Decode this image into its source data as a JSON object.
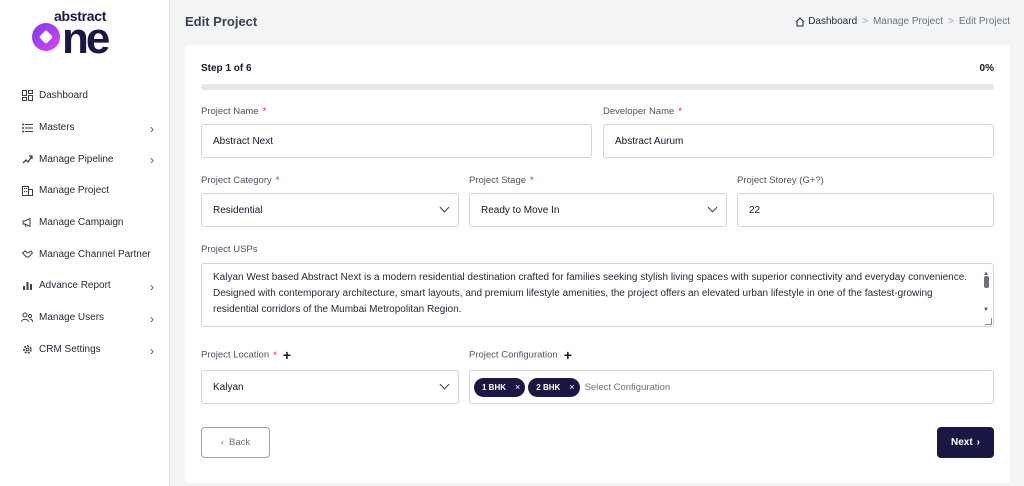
{
  "brand": {
    "top": "abstract",
    "main": "ne"
  },
  "sidebar": {
    "items": [
      {
        "label": "Dashboard",
        "icon": "dashboard-grid-icon",
        "has_children": false
      },
      {
        "label": "Masters",
        "icon": "list-icon",
        "has_children": true
      },
      {
        "label": "Manage Pipeline",
        "icon": "pipeline-icon",
        "has_children": true
      },
      {
        "label": "Manage Project",
        "icon": "building-icon",
        "has_children": false
      },
      {
        "label": "Manage Campaign",
        "icon": "megaphone-icon",
        "has_children": false
      },
      {
        "label": "Manage Channel Partner",
        "icon": "handshake-icon",
        "has_children": false
      },
      {
        "label": "Advance Report",
        "icon": "bar-chart-icon",
        "has_children": true
      },
      {
        "label": "Manage Users",
        "icon": "users-icon",
        "has_children": true
      },
      {
        "label": "CRM Settings",
        "icon": "gear-icon",
        "has_children": true
      }
    ]
  },
  "header": {
    "title": "Edit Project",
    "breadcrumb": [
      "Dashboard",
      "Manage Project",
      "Edit Project"
    ],
    "separator": ">"
  },
  "form": {
    "step_label": "Step 1 of 6",
    "progress_label": "0%",
    "progress_fraction": 0,
    "project_name": {
      "label": "Project Name",
      "required": "*",
      "value": "Abstract Next"
    },
    "developer_name": {
      "label": "Developer Name",
      "required": "*",
      "value": "Abstract Aurum"
    },
    "project_category": {
      "label": "Project Category",
      "required": "*",
      "value": "Residential"
    },
    "project_stage": {
      "label": "Project Stage",
      "required": "*",
      "value": "Ready to Move In"
    },
    "project_storey": {
      "label": "Project Storey (G+?)",
      "value": "22"
    },
    "project_usps": {
      "label": "Project USPs",
      "value": "Kalyan West based Abstract Next is a modern residential destination crafted for families seeking stylish living spaces with superior connectivity and everyday convenience. Designed with contemporary architecture, smart layouts, and premium lifestyle amenities, the project offers an elevated urban lifestyle in one of the fastest-growing residential corridors of the Mumbai Metropolitan Region."
    },
    "project_location": {
      "label": "Project Location",
      "required": "*",
      "add": "+",
      "value": "Kalyan"
    },
    "project_configuration": {
      "label": "Project Configuration",
      "add": "+",
      "chips": [
        "1 BHK",
        "2 BHK"
      ],
      "chip_remove": "×",
      "placeholder": "Select Configuration"
    }
  },
  "buttons": {
    "back": "Back",
    "back_icon": "‹",
    "next": "Next",
    "next_icon": "›"
  },
  "colors": {
    "brand_dark": "#1b1744",
    "accent_gradient": [
      "#7c3aed",
      "#d946ef"
    ],
    "required": "#dc2626"
  }
}
